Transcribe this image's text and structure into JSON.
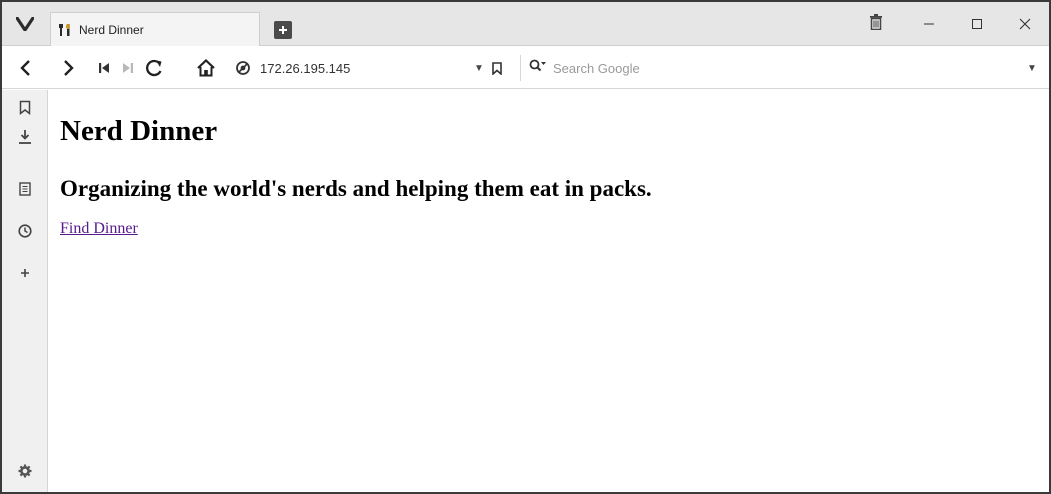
{
  "browser": {
    "tab": {
      "title": "Nerd Dinner"
    },
    "address": {
      "value": "172.26.195.145"
    },
    "search": {
      "placeholder": "Search Google"
    }
  },
  "page": {
    "heading": "Nerd Dinner",
    "subheading": "Organizing the world's nerds and helping them eat in packs.",
    "link_label": "Find Dinner"
  },
  "icons": {
    "menu": "vivaldi-logo-icon",
    "tab_favicon": "fork-knife-icon",
    "new_tab": "plus-icon",
    "trash": "trash-icon",
    "minimize": "minimize-icon",
    "maximize": "maximize-icon",
    "close": "close-icon",
    "back": "chevron-left-icon",
    "forward": "chevron-right-icon",
    "rewind": "rewind-icon",
    "fast_forward": "fast-forward-icon",
    "reload": "reload-icon",
    "home": "home-icon",
    "site_info": "site-info-icon",
    "sidebar": [
      "bookmark-icon",
      "download-icon",
      "notes-icon",
      "history-icon",
      "add-panel-icon",
      "settings-icon"
    ]
  },
  "colors": {
    "tabbar_bg": "#e6e6e6",
    "link_visited": "#551a8b",
    "sidebar_bg": "#f0f0f0"
  }
}
